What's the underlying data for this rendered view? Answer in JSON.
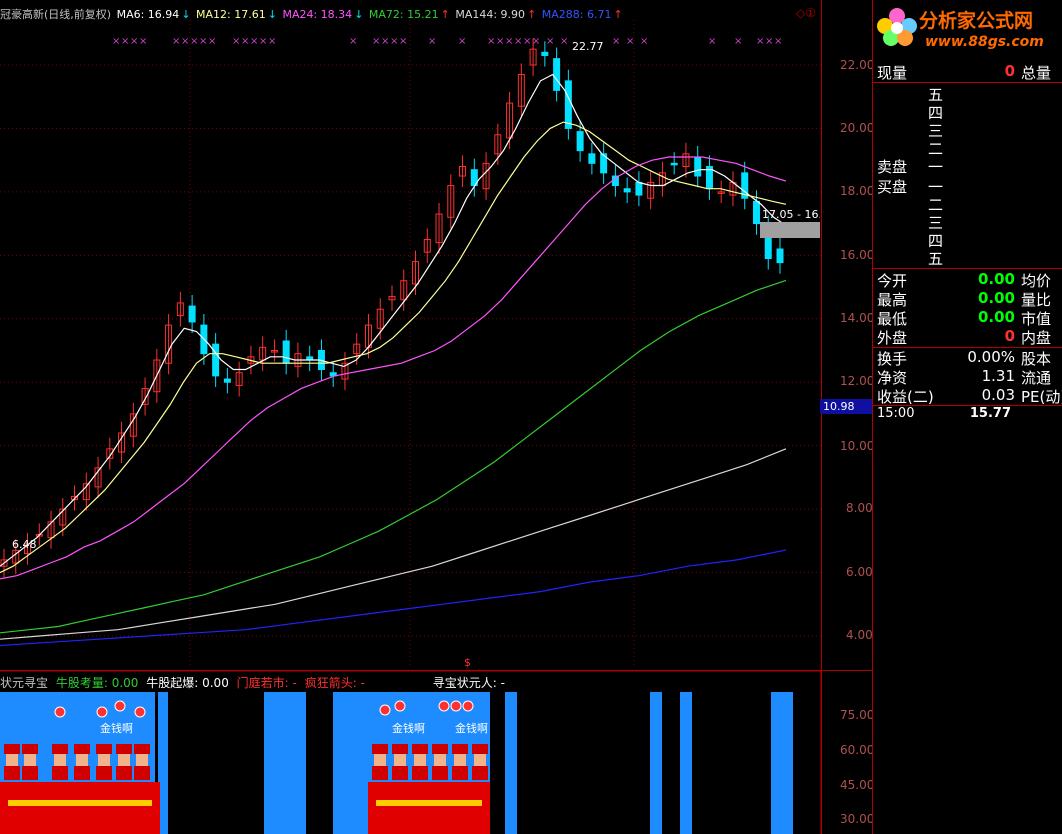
{
  "legend": {
    "title": "冠豪高新(日线,前复权)",
    "ma6": "MA6: 16.94",
    "ma12": "MA12: 17.61",
    "ma24": "MA24: 18.34",
    "ma72": "MA72: 15.21",
    "ma144": "MA144: 9.90",
    "ma288": "MA288: 6.71",
    "arrow_down": "↓",
    "arrow_up": "↑",
    "corner": "◇①"
  },
  "annotations": {
    "high": "22.77",
    "low": "6.48",
    "range_label": "17.05 - 16.",
    "dollar": "$"
  },
  "price_axis": [
    "22.00",
    "20.00",
    "18.00",
    "16.00",
    "14.00",
    "12.00",
    "10.00",
    "8.00",
    "6.00",
    "4.00"
  ],
  "current_price_tag": "10.98",
  "sub_legend": {
    "name": "状元寻宝",
    "i1": "牛股考量: 0.00",
    "i2": "牛股起爆: 0.00",
    "i3": "门庭若市: -",
    "i4": "疯狂箭头: -",
    "i5": "寻宝状元人: -"
  },
  "sub_axis": [
    "75.00",
    "60.00",
    "45.00",
    "30.00"
  ],
  "sub_text": {
    "money1": "金钱啊",
    "money2": "金钱啊",
    "money3": "金钱啊"
  },
  "logo": {
    "text": "分析家公式网",
    "url": "www.88gs.com"
  },
  "quote": {
    "now_vol_label": "现量",
    "now_vol": "0",
    "total_vol_label": "总量",
    "sell_label": "卖盘",
    "buy_label": "买盘",
    "asks": [
      "五",
      "四",
      "三",
      "二",
      "一"
    ],
    "bids": [
      "一",
      "二",
      "三",
      "四",
      "五"
    ],
    "rows1": [
      {
        "label": "今开",
        "value": "0.00",
        "right": "均价"
      },
      {
        "label": "最高",
        "value": "0.00",
        "right": "量比"
      },
      {
        "label": "最低",
        "value": "0.00",
        "right": "市值"
      },
      {
        "label": "外盘",
        "value": "0",
        "right": "内盘"
      }
    ],
    "rows2": [
      {
        "label": "换手",
        "value": "0.00%",
        "right": "股本"
      },
      {
        "label": "净资",
        "value": "1.31",
        "right": "流通"
      },
      {
        "label": "收益(二)",
        "value": "0.03",
        "right": "PE(动)"
      }
    ],
    "time": "15:00",
    "time_price": "15.77"
  },
  "chart_data": {
    "type": "line",
    "title": "冠豪高新(日线,前复权)",
    "ylim": [
      3.5,
      23.5
    ],
    "y_ticks": [
      4,
      6,
      8,
      10,
      12,
      14,
      16,
      18,
      20,
      22
    ],
    "candles_close": [
      6.4,
      6.7,
      6.9,
      7.2,
      7.6,
      8.0,
      8.4,
      8.8,
      9.3,
      9.9,
      10.4,
      11.0,
      11.8,
      12.7,
      13.8,
      14.5,
      13.9,
      12.9,
      12.2,
      12.0,
      12.3,
      12.8,
      13.1,
      13.0,
      12.6,
      12.9,
      12.7,
      12.4,
      12.2,
      12.6,
      13.2,
      13.8,
      14.3,
      14.7,
      15.2,
      15.8,
      16.5,
      17.3,
      18.2,
      18.8,
      18.2,
      18.9,
      19.8,
      20.8,
      21.7,
      22.5,
      22.3,
      21.2,
      20.0,
      19.3,
      18.9,
      18.6,
      18.2,
      18.0,
      17.9,
      18.3,
      18.6,
      18.9,
      19.2,
      18.5,
      18.1,
      18.0,
      18.3,
      17.8,
      17.0,
      15.9,
      15.77
    ],
    "series": [
      {
        "name": "MA6",
        "values": [
          6.2,
          6.5,
          6.8,
          7.1,
          7.5,
          7.9,
          8.3,
          8.7,
          9.2,
          9.7,
          10.3,
          10.9,
          11.6,
          12.4,
          13.2,
          13.7,
          13.6,
          13.2,
          12.7,
          12.4,
          12.4,
          12.6,
          12.8,
          12.8,
          12.7,
          12.7,
          12.7,
          12.6,
          12.5,
          12.7,
          13.1,
          13.6,
          14.1,
          14.6,
          15.1,
          15.7,
          16.3,
          17.0,
          17.8,
          18.4,
          18.8,
          19.3,
          20.0,
          20.8,
          21.5,
          21.7,
          21.2,
          20.4,
          19.7,
          19.2,
          18.9,
          18.6,
          18.3,
          18.2,
          18.2,
          18.4,
          18.6,
          18.7,
          18.7,
          18.5,
          18.2,
          17.9,
          17.6,
          17.2,
          16.94
        ]
      },
      {
        "name": "MA12",
        "values": [
          6.0,
          6.2,
          6.5,
          6.8,
          7.1,
          7.4,
          7.8,
          8.2,
          8.6,
          9.1,
          9.6,
          10.1,
          10.7,
          11.3,
          12.0,
          12.6,
          12.9,
          12.9,
          12.8,
          12.7,
          12.6,
          12.6,
          12.6,
          12.6,
          12.6,
          12.6,
          12.7,
          12.8,
          12.9,
          13.1,
          13.4,
          13.8,
          14.2,
          14.7,
          15.2,
          15.8,
          16.5,
          17.2,
          17.9,
          18.5,
          19.1,
          19.6,
          20.0,
          20.2,
          20.1,
          19.9,
          19.6,
          19.3,
          19.0,
          18.8,
          18.6,
          18.4,
          18.3,
          18.2,
          18.1,
          18.1,
          18.0,
          17.9,
          17.8,
          17.7,
          17.61
        ]
      },
      {
        "name": "MA24",
        "values": [
          5.8,
          5.9,
          6.1,
          6.3,
          6.5,
          6.8,
          7.0,
          7.3,
          7.6,
          8.0,
          8.4,
          8.8,
          9.3,
          9.8,
          10.3,
          10.8,
          11.2,
          11.5,
          11.8,
          12.0,
          12.2,
          12.3,
          12.4,
          12.5,
          12.6,
          12.8,
          13.0,
          13.3,
          13.7,
          14.1,
          14.6,
          15.2,
          15.8,
          16.4,
          17.0,
          17.6,
          18.1,
          18.5,
          18.8,
          19.0,
          19.1,
          19.1,
          19.1,
          19.0,
          18.9,
          18.7,
          18.5,
          18.34
        ]
      },
      {
        "name": "MA72",
        "values": [
          4.1,
          4.2,
          4.3,
          4.5,
          4.7,
          4.9,
          5.1,
          5.3,
          5.6,
          5.9,
          6.2,
          6.5,
          6.9,
          7.3,
          7.8,
          8.3,
          8.9,
          9.5,
          10.2,
          10.9,
          11.6,
          12.3,
          13.0,
          13.6,
          14.1,
          14.5,
          14.9,
          15.21
        ]
      },
      {
        "name": "MA144",
        "values": [
          3.9,
          4.0,
          4.1,
          4.2,
          4.4,
          4.6,
          4.8,
          5.0,
          5.3,
          5.6,
          5.9,
          6.2,
          6.6,
          7.0,
          7.4,
          7.8,
          8.2,
          8.6,
          9.0,
          9.4,
          9.9
        ]
      },
      {
        "name": "MA288",
        "values": [
          3.7,
          3.8,
          3.9,
          4.0,
          4.1,
          4.2,
          4.4,
          4.6,
          4.8,
          5.0,
          5.2,
          5.4,
          5.7,
          5.9,
          6.2,
          6.4,
          6.71
        ]
      }
    ],
    "colors": {
      "MA6": "#ffffff",
      "MA12": "#ffff99",
      "MA24": "#ff55ff",
      "MA72": "#33cc33",
      "MA144": "#d8d8d8",
      "MA288": "#2222ff",
      "up": "#ff3030",
      "down": "#00e0ff"
    }
  }
}
